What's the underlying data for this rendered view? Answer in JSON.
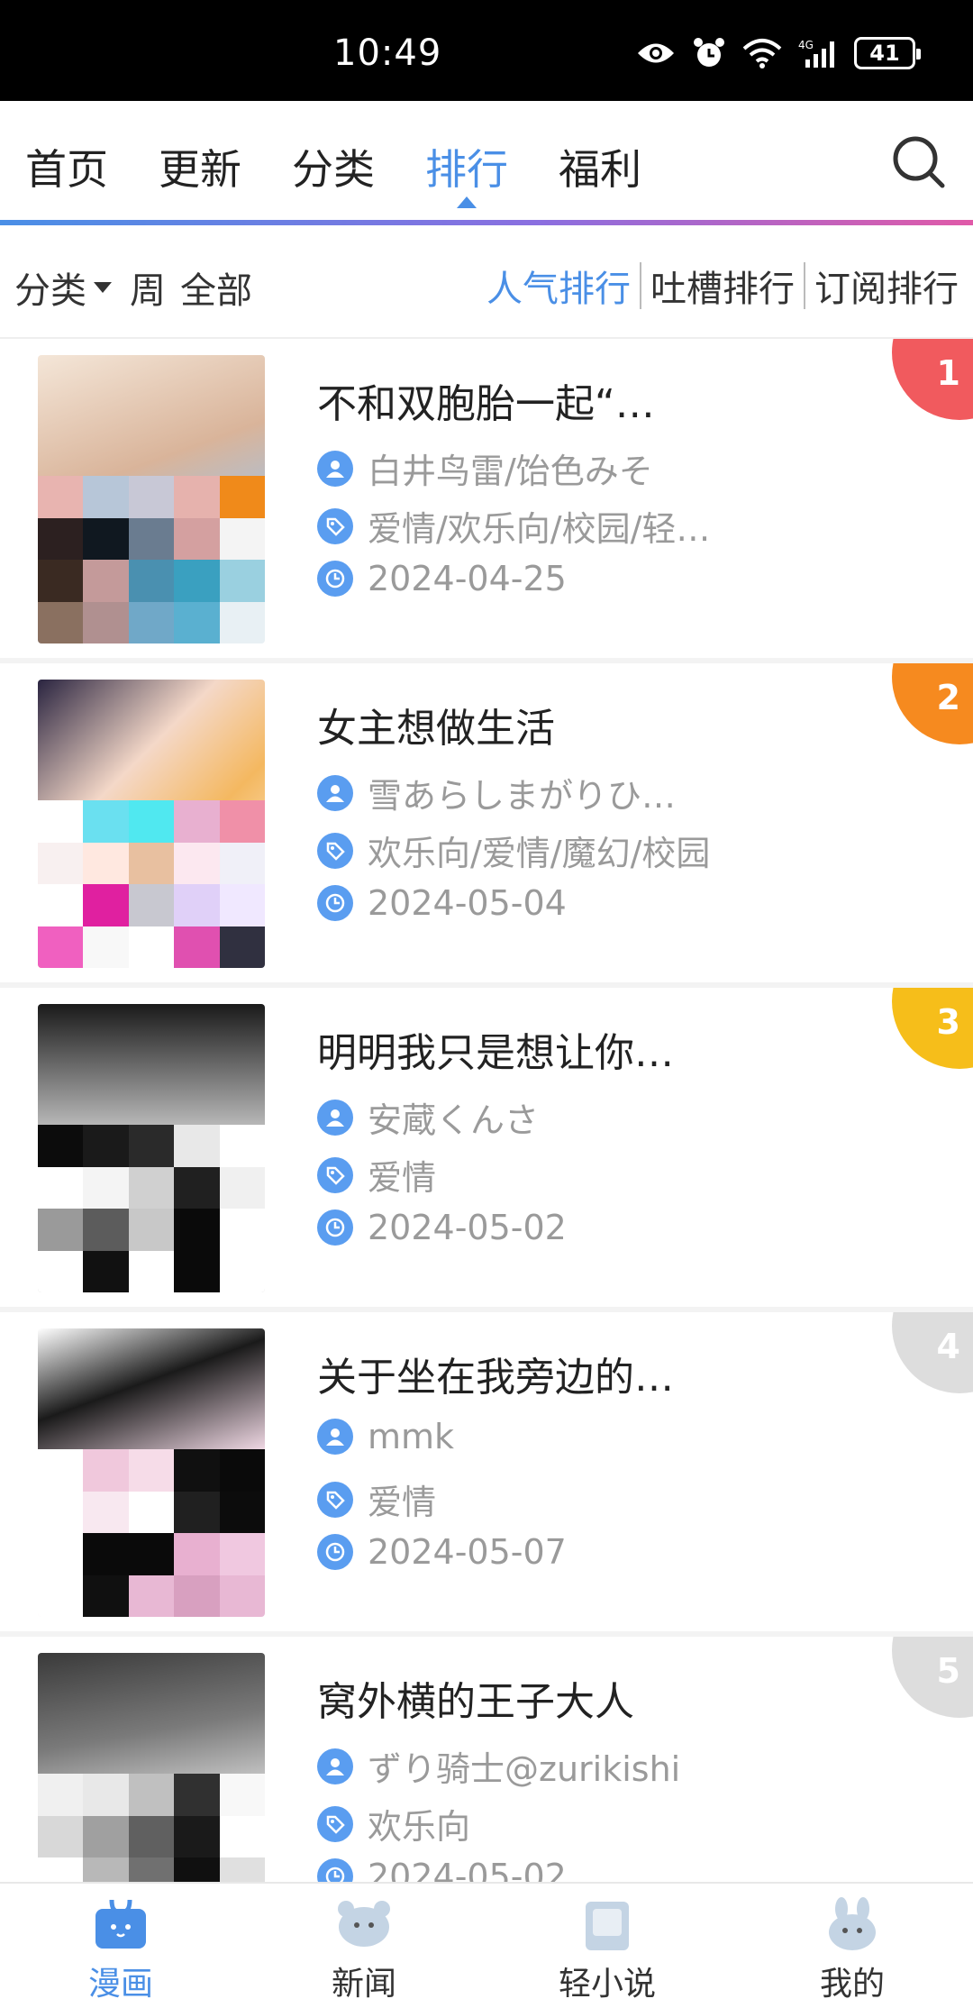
{
  "status_bar": {
    "time": "10:49",
    "battery": "41"
  },
  "top_nav": {
    "tabs": [
      {
        "label": "首页"
      },
      {
        "label": "更新"
      },
      {
        "label": "分类"
      },
      {
        "label": "排行"
      },
      {
        "label": "福利"
      }
    ],
    "active_tab": "排行"
  },
  "filter": {
    "category_label": "分类",
    "period_label": "周",
    "scope_label": "全部",
    "sort_tabs": [
      {
        "label": "人气排行"
      },
      {
        "label": "吐槽排行"
      },
      {
        "label": "订阅排行"
      }
    ],
    "active_sort": "人气排行"
  },
  "rankings": [
    {
      "rank": "1",
      "title": "不和双胞胎一起“…",
      "author": "白井鸟雷/饴色みそ",
      "tags": "爱情/欢乐向/校园/轻…",
      "date": "2024-04-25",
      "rank_color": "#f15a5e"
    },
    {
      "rank": "2",
      "title": "女主想做生活",
      "author": "雪あらしまがりひ…",
      "tags": "欢乐向/爱情/魔幻/校园",
      "date": "2024-05-04",
      "rank_color": "#f68a1f"
    },
    {
      "rank": "3",
      "title": "明明我只是想让你…",
      "author": "安蔵くんさ",
      "tags": "爱情",
      "date": "2024-05-02",
      "rank_color": "#f6be1a"
    },
    {
      "rank": "4",
      "title": "关于坐在我旁边的…",
      "author": "mmk",
      "tags": "爱情",
      "date": "2024-05-07",
      "rank_color": "#dddddd"
    },
    {
      "rank": "5",
      "title": "窝外横的王子大人",
      "author": "ずり骑士@zurikishi",
      "tags": "欢乐向",
      "date": "2024-05-02",
      "rank_color": "#dddddd"
    }
  ],
  "bottom_nav": {
    "items": [
      {
        "label": "漫画"
      },
      {
        "label": "新闻"
      },
      {
        "label": "轻小说"
      },
      {
        "label": "我的"
      }
    ],
    "active": "漫画"
  },
  "colors": {
    "accent": "#4a8fe6",
    "meta_text": "#9a9a9a"
  }
}
